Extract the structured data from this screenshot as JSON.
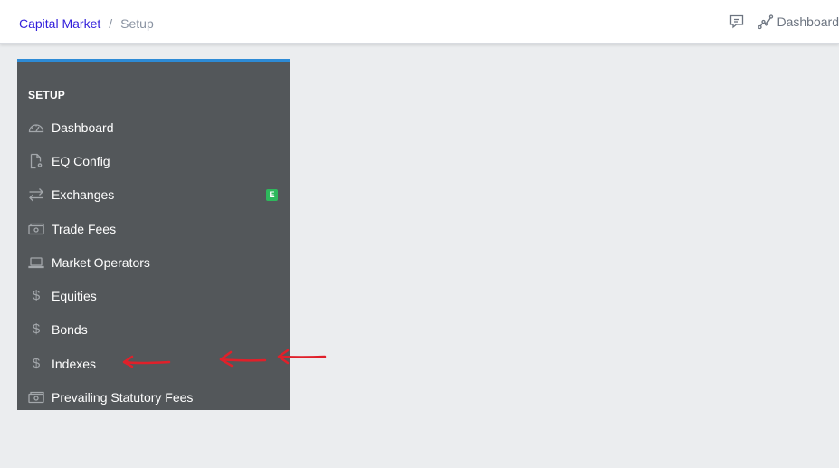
{
  "breadcrumb": {
    "items": [
      "Capital Market",
      "Setup"
    ],
    "separator": "/"
  },
  "header": {
    "right_link_label": "Dashboard",
    "icons": [
      "chat-icon",
      "graph-icon"
    ]
  },
  "panel": {
    "title": "SETUP",
    "accent_color": "#2d8bd6",
    "background_color": "#53575a"
  },
  "menu": {
    "items": [
      {
        "label": "Dashboard",
        "icon": "speedometer-icon"
      },
      {
        "label": "EQ Config",
        "icon": "file-settings-icon"
      },
      {
        "label": "Exchanges",
        "icon": "swap-arrows-icon",
        "badge": "E",
        "badge_color": "#2eb85c"
      },
      {
        "label": "Trade Fees",
        "icon": "money-icon"
      },
      {
        "label": "Market Operators",
        "icon": "laptop-icon"
      },
      {
        "label": "Equities",
        "icon": "dollar-icon",
        "glyph": "$"
      },
      {
        "label": "Bonds",
        "icon": "dollar-icon",
        "glyph": "$"
      },
      {
        "label": "Indexes",
        "icon": "dollar-icon",
        "glyph": "$"
      },
      {
        "label": "Prevailing Statutory Fees",
        "icon": "money-icon"
      }
    ]
  },
  "annotation_color": "#e0202a"
}
